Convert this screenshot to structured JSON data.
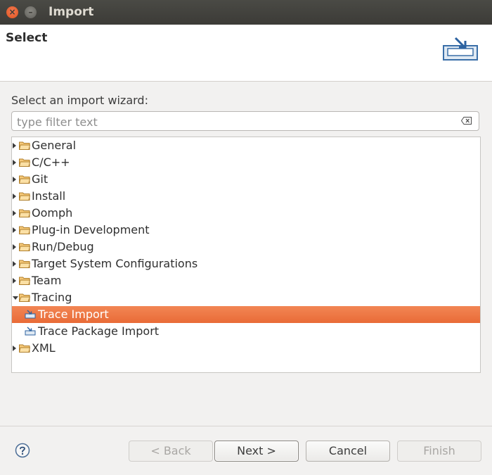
{
  "window": {
    "title": "Import"
  },
  "header": {
    "title": "Select"
  },
  "wizard": {
    "label": "Select an import wizard:",
    "filter_placeholder": "type filter text"
  },
  "tree": {
    "items": [
      {
        "label": "General",
        "type": "folder",
        "expanded": false
      },
      {
        "label": "C/C++",
        "type": "folder",
        "expanded": false
      },
      {
        "label": "Git",
        "type": "folder",
        "expanded": false
      },
      {
        "label": "Install",
        "type": "folder",
        "expanded": false
      },
      {
        "label": "Oomph",
        "type": "folder",
        "expanded": false
      },
      {
        "label": "Plug-in Development",
        "type": "folder",
        "expanded": false
      },
      {
        "label": "Run/Debug",
        "type": "folder",
        "expanded": false
      },
      {
        "label": "Target System Configurations",
        "type": "folder",
        "expanded": false
      },
      {
        "label": "Team",
        "type": "folder",
        "expanded": false
      },
      {
        "label": "Tracing",
        "type": "folder",
        "expanded": true
      },
      {
        "label": "Trace Import",
        "type": "wizard",
        "selected": true
      },
      {
        "label": "Trace Package Import",
        "type": "wizard",
        "selected": false
      },
      {
        "label": "XML",
        "type": "folder",
        "expanded": false
      }
    ]
  },
  "buttons": {
    "back": "< Back",
    "next": "Next >",
    "cancel": "Cancel",
    "finish": "Finish"
  },
  "colors": {
    "selection": "#e96b37",
    "titlebar": "#3c3b37",
    "close_button": "#e0531f"
  }
}
